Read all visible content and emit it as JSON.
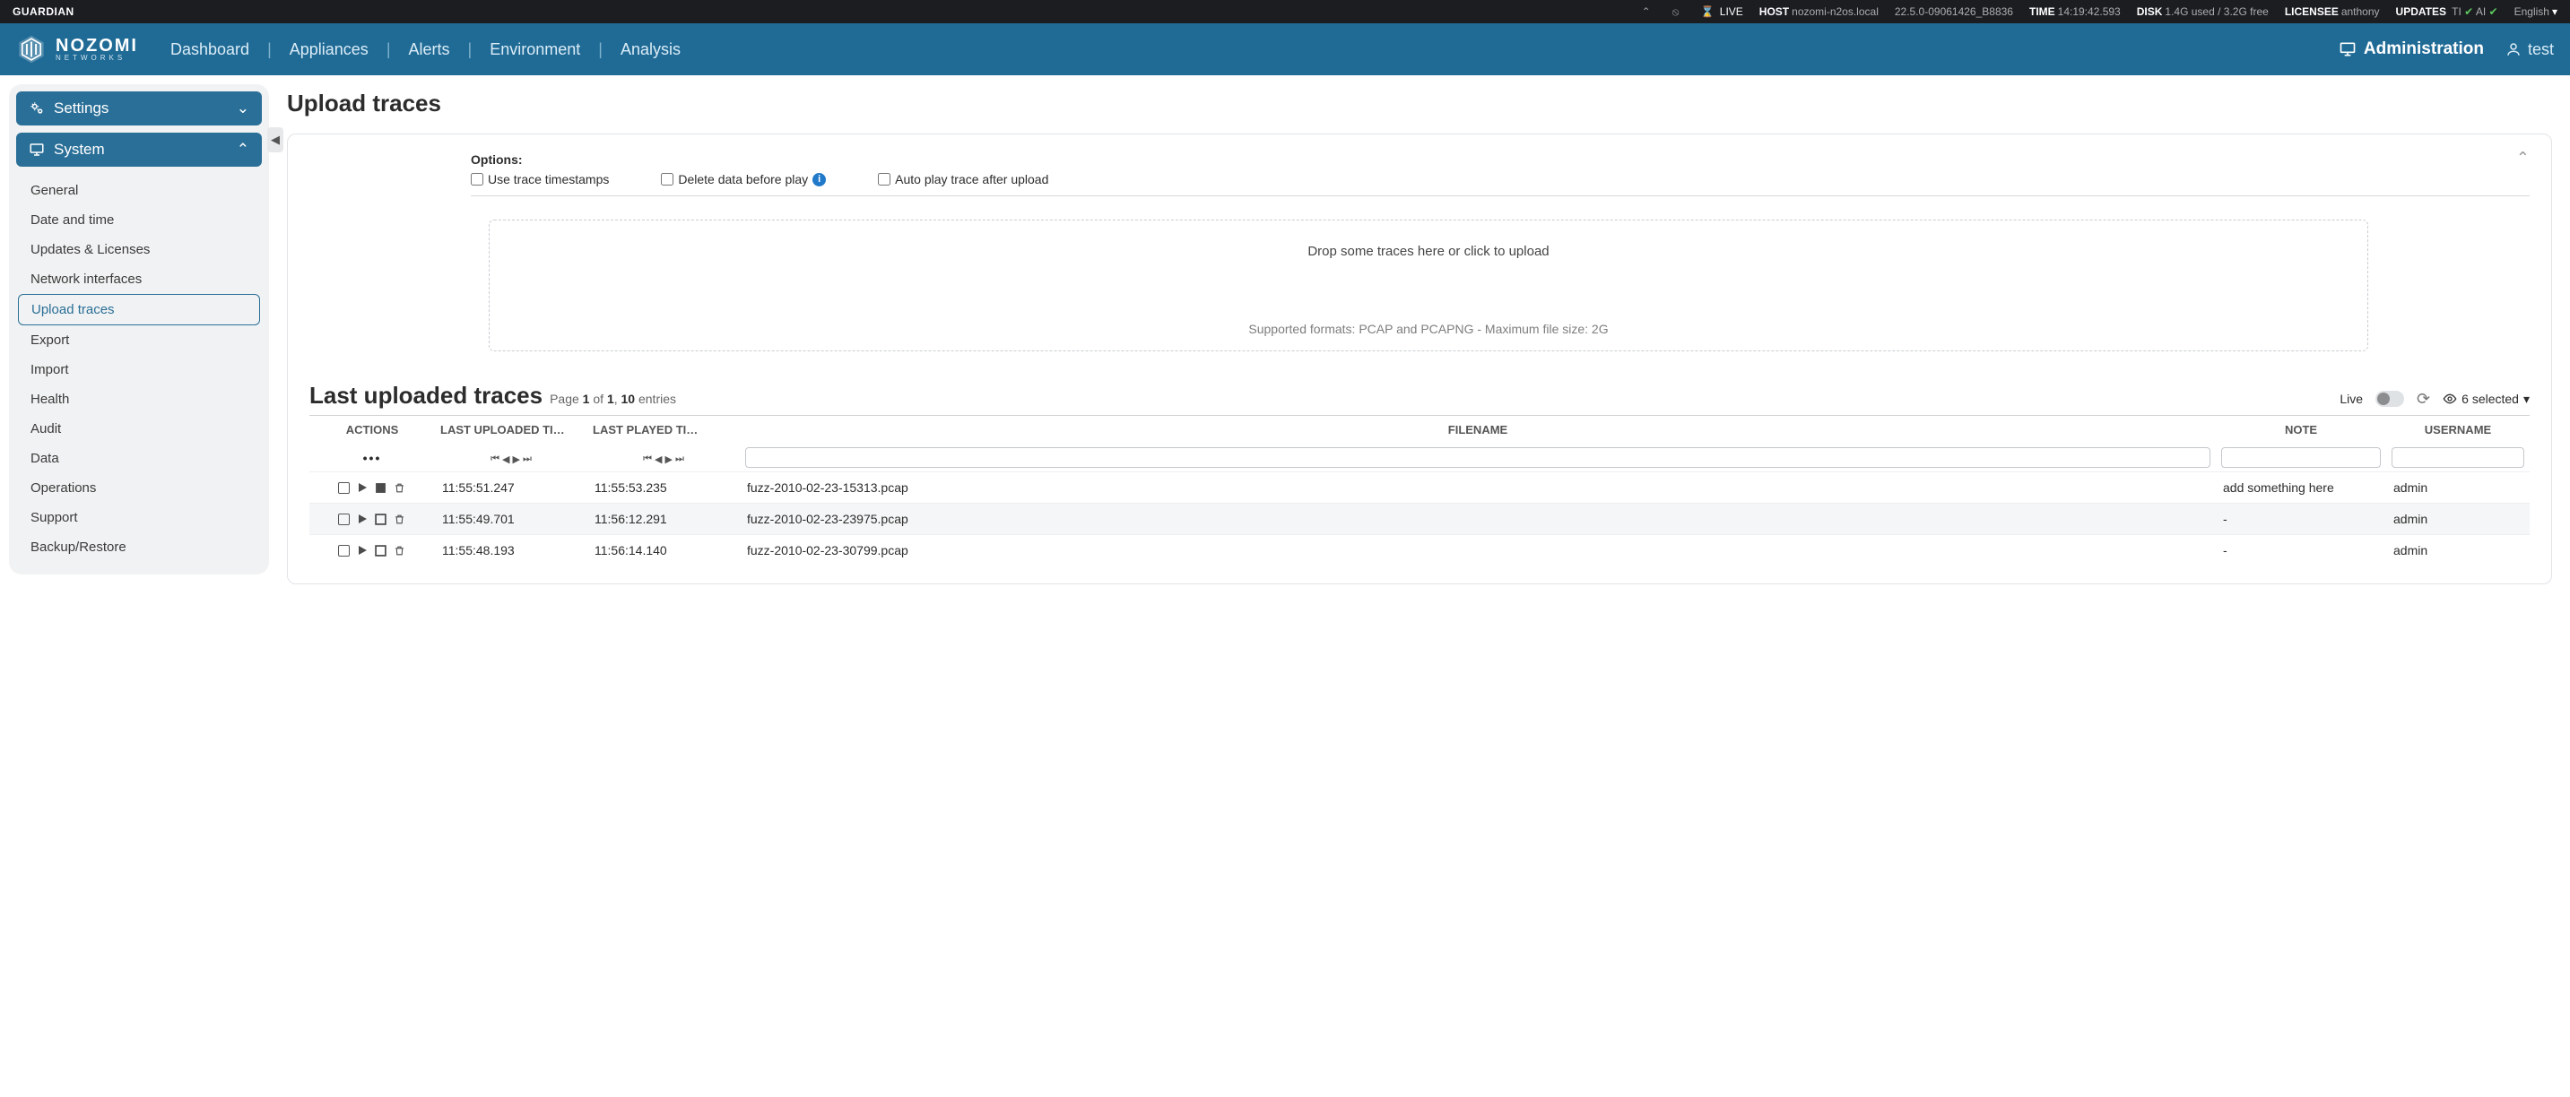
{
  "topbar": {
    "product": "GUARDIAN",
    "live": "LIVE",
    "host_label": "HOST",
    "host": "nozomi-n2os.local",
    "version": "22.5.0-09061426_B8836",
    "time_label": "TIME",
    "time": "14:19:42.593",
    "disk_label": "DISK",
    "disk": "1.4G used / 3.2G free",
    "licensee_label": "LICENSEE",
    "licensee": "anthony",
    "updates_label": "UPDATES",
    "updates_ti": "TI",
    "updates_ai": "AI",
    "lang": "English"
  },
  "header": {
    "nav": [
      "Dashboard",
      "Appliances",
      "Alerts",
      "Environment",
      "Analysis"
    ],
    "admin": "Administration",
    "user": "test",
    "logo_name": "NOZOMI",
    "logo_sub": "NETWORKS"
  },
  "sidebar": {
    "sections": [
      {
        "icon": "gears",
        "label": "Settings",
        "open": false
      },
      {
        "icon": "monitor",
        "label": "System",
        "open": true
      }
    ],
    "items": [
      "General",
      "Date and time",
      "Updates & Licenses",
      "Network interfaces",
      "Upload traces",
      "Export",
      "Import",
      "Health",
      "Audit",
      "Data",
      "Operations",
      "Support",
      "Backup/Restore"
    ],
    "active_index": 4
  },
  "page": {
    "title": "Upload traces",
    "options_heading": "Options:",
    "opt_timestamps": "Use trace timestamps",
    "opt_delete": "Delete data before play",
    "opt_autoplay": "Auto play trace after upload",
    "dropzone_msg": "Drop some traces here or click to upload",
    "dropzone_support": "Supported formats: PCAP and PCAPNG - Maximum file size: 2G"
  },
  "list": {
    "title": "Last uploaded traces",
    "page_prefix": "Page ",
    "page_num": "1",
    "of": " of ",
    "page_total": "1",
    "sep": ", ",
    "entries": "10",
    "entries_suffix": " entries",
    "live_label": "Live",
    "selected_count": "6 selected",
    "columns": {
      "actions": "ACTIONS",
      "uploaded": "LAST UPLOADED TI…",
      "played": "LAST PLAYED TI…",
      "filename": "FILENAME",
      "note": "NOTE",
      "username": "USERNAME"
    },
    "rows": [
      {
        "uploaded": "11:55:51.247",
        "played": "11:55:53.235",
        "filename": "fuzz-2010-02-23-15313.pcap",
        "note": "add something here",
        "username": "admin",
        "stop_icon": true
      },
      {
        "uploaded": "11:55:49.701",
        "played": "11:56:12.291",
        "filename": "fuzz-2010-02-23-23975.pcap",
        "note": "-",
        "username": "admin",
        "stop_icon": false
      },
      {
        "uploaded": "11:55:48.193",
        "played": "11:56:14.140",
        "filename": "fuzz-2010-02-23-30799.pcap",
        "note": "-",
        "username": "admin",
        "stop_icon": false
      }
    ]
  }
}
